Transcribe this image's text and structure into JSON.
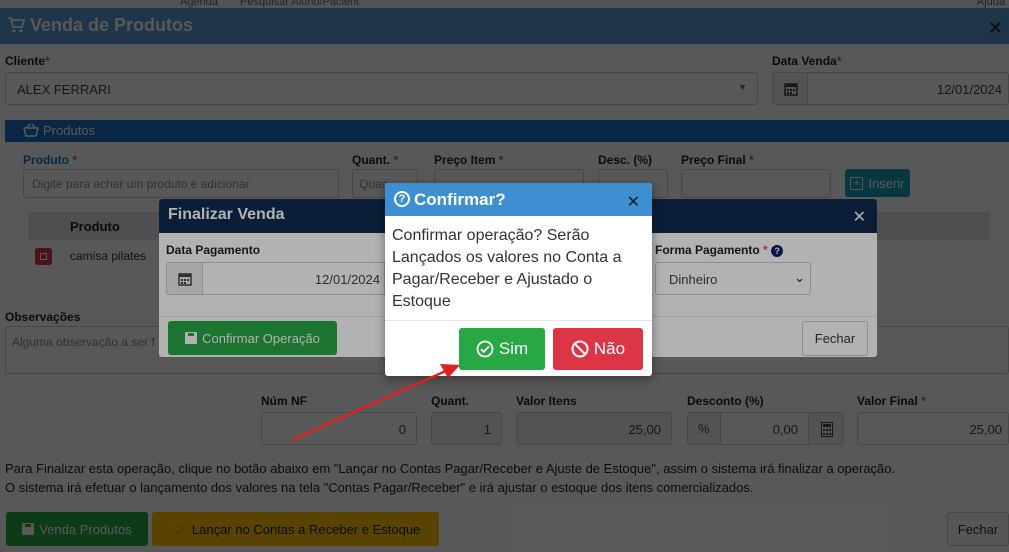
{
  "topnav": {
    "agenda": "Agenda",
    "search_placeholder": "Pesquisar Aluno/Pacient",
    "help": "Ajuda"
  },
  "main_modal": {
    "title": "Venda de Produtos"
  },
  "cliente": {
    "label": "Cliente",
    "value": "ALEX FERRARI"
  },
  "data_venda": {
    "label": "Data Venda",
    "value": "12/01/2024"
  },
  "produtos_section": {
    "title": "Produtos"
  },
  "produto_field": {
    "label": "Produto",
    "placeholder": "Digite para achar um produto e adicionar"
  },
  "quant_field": {
    "label": "Quant.",
    "placeholder": "Quan"
  },
  "preco_item": {
    "label": "Preço Item"
  },
  "desc_field": {
    "label": "Desc. (%)"
  },
  "preco_final": {
    "label": "Preço Final"
  },
  "inserir_button": "Inserir",
  "table": {
    "header_produto": "Produto",
    "row_produto": "camisa pilates"
  },
  "observacoes": {
    "label": "Observações",
    "placeholder": "Alguma observação a ser f"
  },
  "totals": {
    "num_nf": {
      "label": "Núm NF",
      "value": "0"
    },
    "quant": {
      "label": "Quant.",
      "value": "1"
    },
    "valor_itens": {
      "label": "Valor Itens",
      "value": "25,00"
    },
    "desconto": {
      "label": "Desconto (%)",
      "prefix": "%",
      "value": "0,00"
    },
    "valor_final": {
      "label": "Valor Final",
      "value": "25,00"
    }
  },
  "instructions": {
    "line1": "Para Finalizar esta operação, clique no botão abaixo em \"Lançar no Contas Pagar/Receber e Ajuste de Estoque\", assim o sistema irá finalizar a operação.",
    "line2": "O sistema irá efetuar o lançamento dos valores na tela \"Contas Pagar/Receber\" e irá ajustar o estoque dos itens comercializados."
  },
  "footer": {
    "venda_produtos": "Venda Produtos",
    "lancar": "Lançar no Contas a Receber e Estoque",
    "fechar": "Fechar"
  },
  "finalizar": {
    "title": "Finalizar Venda",
    "data_pagamento_label": "Data Pagamento",
    "data_pagamento_value": "12/01/2024",
    "forma_pagamento_label": "Forma Pagamento",
    "forma_pagamento_value": "Dinheiro",
    "confirmar_button": "Confirmar Operação",
    "fechar_button": "Fechar"
  },
  "confirm_dialog": {
    "title": "Confirmar?",
    "message": "Confirmar operação? Serão Lançados os valores no Conta a Pagar/Receber e Ajustado o Estoque",
    "sim": "Sim",
    "nao": "Não"
  },
  "colors": {
    "header_blue": "#5a9bd5",
    "section_blue": "#1a73c7",
    "modal_navy": "#0f2d4f",
    "confirm_blue": "#3d8fd1",
    "success": "#28a745",
    "danger": "#dc3545",
    "warning": "#ffc107",
    "info": "#17a2b8",
    "arrow_red": "#e02020"
  }
}
